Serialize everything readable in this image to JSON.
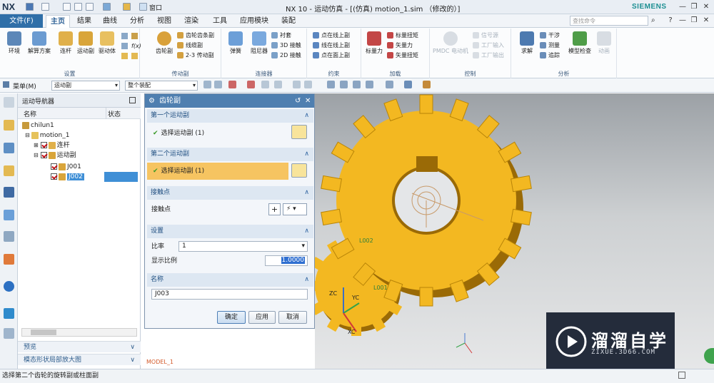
{
  "app": {
    "logo": "NX",
    "window_title": "NX 10 - 运动仿真 - [(仿真) motion_1.sim （修改的）]",
    "brand": "SIEMENS",
    "window_menu": "窗口"
  },
  "menu": {
    "file_tab": "文件(F)",
    "tabs": [
      "主页",
      "结果",
      "曲线",
      "分析",
      "视图",
      "渲染",
      "工具",
      "应用模块",
      "装配"
    ],
    "active_tab": "主页",
    "search_placeholder": "查找命令"
  },
  "ribbon": {
    "groups": [
      {
        "label": "设置",
        "buttons": [
          "环境",
          "解算方案",
          "连杆",
          "运动副",
          "驱动体"
        ]
      },
      {
        "label": "传动副",
        "buttons": [
          "齿轮副"
        ],
        "small": [
          "齿轮齿条副",
          "线缆副",
          "2-3 传动副"
        ]
      },
      {
        "label": "连接器",
        "buttons": [
          "弹簧",
          "阻尼器"
        ],
        "small": [
          "衬套",
          "3D 接触",
          "2D 接触"
        ]
      },
      {
        "label": "约束",
        "small": [
          "点在线上副",
          "线在线上副",
          "点在面上副"
        ]
      },
      {
        "label": "加载",
        "buttons": [
          "标量力"
        ],
        "small": [
          "标量扭矩",
          "矢量力",
          "矢量扭矩"
        ]
      },
      {
        "label": "控制",
        "buttons": [
          "PMDC 电动机"
        ],
        "small": [
          "信号源",
          "工厂输入",
          "工厂输出"
        ]
      },
      {
        "label": "分析",
        "buttons": [
          "求解",
          "模型检查",
          "动画"
        ],
        "small": [
          "干涉",
          "测量",
          "追踪"
        ]
      }
    ]
  },
  "toolbar": {
    "menu_label": "菜单(M)",
    "filter_combo": "运动副",
    "scope_combo": "整个装配"
  },
  "navigator": {
    "title": "运动导航器",
    "col_name": "名称",
    "col_status": "状态",
    "tree": [
      {
        "label": "chilun1",
        "indent": 0
      },
      {
        "label": "motion_1",
        "indent": 1
      },
      {
        "label": "连杆",
        "indent": 2
      },
      {
        "label": "运动副",
        "indent": 2
      },
      {
        "label": "J001",
        "indent": 3
      },
      {
        "label": "J002",
        "indent": 3
      }
    ],
    "selected": "J002",
    "preview": "预览",
    "local_zoom": "模态形状局部放大图"
  },
  "dialog": {
    "title": "齿轮副",
    "first_joint_section": "第一个运动副",
    "first_joint_select": "选择运动副 (1)",
    "second_joint_section": "第二个运动副",
    "second_joint_select": "选择运动副 (1)",
    "contact_section": "接触点",
    "contact_label": "接触点",
    "settings_section": "设置",
    "ratio_label": "比率",
    "ratio_value": "1",
    "display_ratio_label": "显示比例",
    "display_ratio_value": "1.0000",
    "name_section": "名称",
    "name_value": "J003",
    "ok": "确定",
    "apply": "应用",
    "cancel": "取消"
  },
  "viewport": {
    "labels": [
      "L002",
      "L001",
      "ZC",
      "YC",
      "XC",
      "MODEL_1"
    ],
    "watermark_title": "溜溜自学",
    "watermark_url": "ZIXUE.3D66.COM",
    "gear_color": "#f3b821",
    "gear_side_color": "#9a6a06"
  },
  "status": {
    "message": "选择第二个齿轮的旋转副或柱面副"
  }
}
